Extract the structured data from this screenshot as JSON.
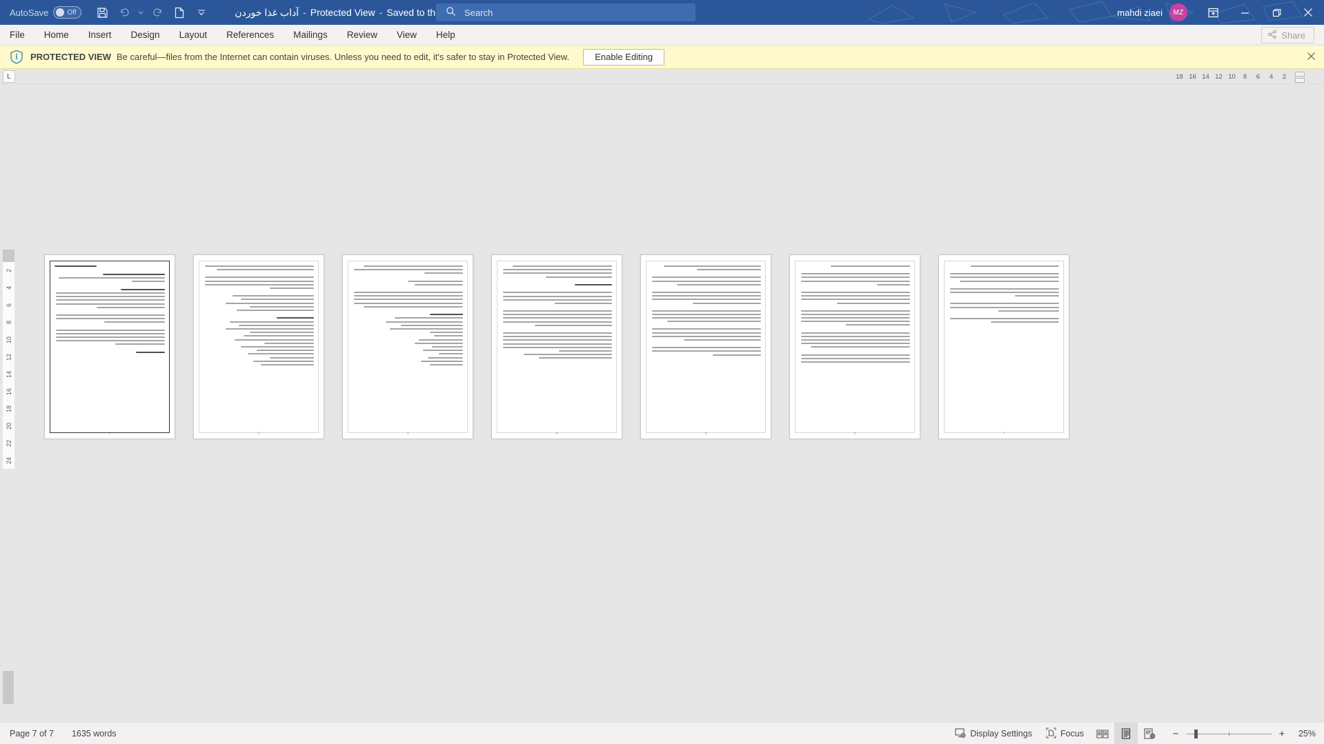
{
  "titlebar": {
    "autosave_label": "AutoSave",
    "autosave_state": "Off",
    "save_icon": "save-icon",
    "undo_icon": "undo-icon",
    "redo_icon": "redo-icon",
    "newdoc_icon": "new-document-icon",
    "customize_icon": "customize-quick-access-toolbar-icon",
    "doc_name": "آداب غذا خوردن",
    "sep1": "-",
    "protected_view_label": "Protected View",
    "sep2": "-",
    "saved_location": "Saved to this PC",
    "saved_caret": "▾",
    "search_icon": "search-icon",
    "search_placeholder": "Search",
    "user_name": "mahdi ziaei",
    "avatar_initials": "MZ",
    "ribbon_display_icon": "ribbon-display-options-icon",
    "minimize_icon": "minimize-icon",
    "restore_icon": "restore-icon",
    "close_icon": "close-icon",
    "accent_color": "#2b579a",
    "avatar_color": "#c543a5"
  },
  "ribbon": {
    "tabs": [
      {
        "label": "File"
      },
      {
        "label": "Home"
      },
      {
        "label": "Insert"
      },
      {
        "label": "Design"
      },
      {
        "label": "Layout"
      },
      {
        "label": "References"
      },
      {
        "label": "Mailings"
      },
      {
        "label": "Review"
      },
      {
        "label": "View"
      },
      {
        "label": "Help"
      }
    ],
    "share_label": "Share",
    "share_icon": "share-icon"
  },
  "protected_view": {
    "icon": "shield-info-icon",
    "title": "PROTECTED VIEW",
    "message": "Be careful—files from the Internet can contain viruses. Unless you need to edit, it's safer to stay in Protected View.",
    "button_label": "Enable Editing",
    "close_icon": "close-icon",
    "background": "#fff9cc"
  },
  "ruler": {
    "tab_stop_glyph": "L",
    "horizontal_ticks": [
      "18",
      "16",
      "14",
      "12",
      "10",
      "8",
      "6",
      "4",
      "2"
    ],
    "vertical_ticks": [
      "2",
      "2",
      "4",
      "6",
      "8",
      "10",
      "12",
      "14",
      "16",
      "18",
      "20",
      "22",
      "24"
    ]
  },
  "document": {
    "zoom_level": "25%",
    "pages": [
      {
        "number": "1"
      },
      {
        "number": "2"
      },
      {
        "number": "3"
      },
      {
        "number": "4"
      },
      {
        "number": "5"
      },
      {
        "number": "6"
      },
      {
        "number": "7"
      }
    ]
  },
  "statusbar": {
    "page_indicator": "Page 7 of 7",
    "word_count": "1635 words",
    "display_settings_label": "Display Settings",
    "display_settings_icon": "display-settings-icon",
    "focus_label": "Focus",
    "focus_icon": "focus-icon",
    "read_mode_icon": "read-mode-icon",
    "print_layout_icon": "print-layout-icon",
    "web_layout_icon": "web-layout-icon",
    "zoom_out_label": "−",
    "zoom_in_label": "+",
    "zoom_value": "25%"
  }
}
